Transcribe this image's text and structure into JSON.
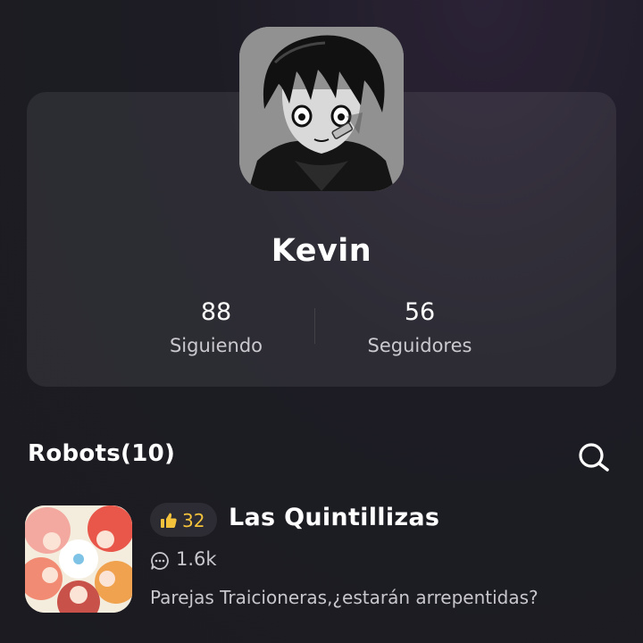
{
  "profile": {
    "username": "Kevin",
    "following_count": "88",
    "following_label": "Siguiendo",
    "followers_count": "56",
    "followers_label": "Seguidores"
  },
  "robots_section": {
    "title": "Robots(10)",
    "search_icon": "search-icon"
  },
  "robots": [
    {
      "name": "Las Quintillizas",
      "likes": "32",
      "comments": "1.6k",
      "description": "Parejas Traicioneras,¿estarán arrepentidas?"
    }
  ],
  "colors": {
    "background": "#1d1c24",
    "card": "#2a2a32",
    "like_accent": "#f5c23c",
    "secondary_text": "#c7c7cc"
  }
}
